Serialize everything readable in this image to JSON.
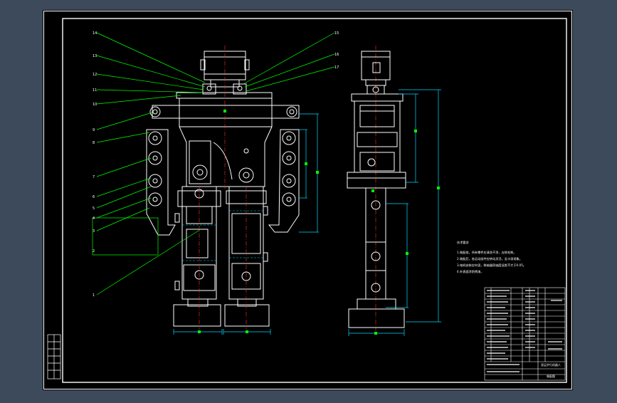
{
  "background": {
    "window": "#3c4a5c",
    "drawing": "#000000"
  },
  "colors": {
    "outline": "#ffffff",
    "leader": "#00ff00",
    "dimension": "#00d9ff",
    "label": "#ffffff",
    "center": "#ff3333",
    "highlight": "#ffff00"
  },
  "balloons_left": [
    "14",
    "13",
    "12",
    "11",
    "10",
    "9",
    "8",
    "7",
    "6",
    "5",
    "4",
    "3",
    "2",
    "1"
  ],
  "balloons_right": [
    "15",
    "16",
    "17"
  ],
  "notes": {
    "heading": "技术要求",
    "lines": [
      "1.装配前，所有零件应清洗干净，去除毛刺。",
      "2.装配后，各运动部件应转动灵活，无卡滞现象。",
      "3.电机安装应牢固，联轴器同轴度误差不大于0.05。",
      "4.外表面涂防锈漆。"
    ]
  },
  "title_block": {
    "title": "双足步行机器人",
    "drawing_no": "装配图"
  },
  "icons": {
    "drawing": "cad-drawing-icon"
  }
}
